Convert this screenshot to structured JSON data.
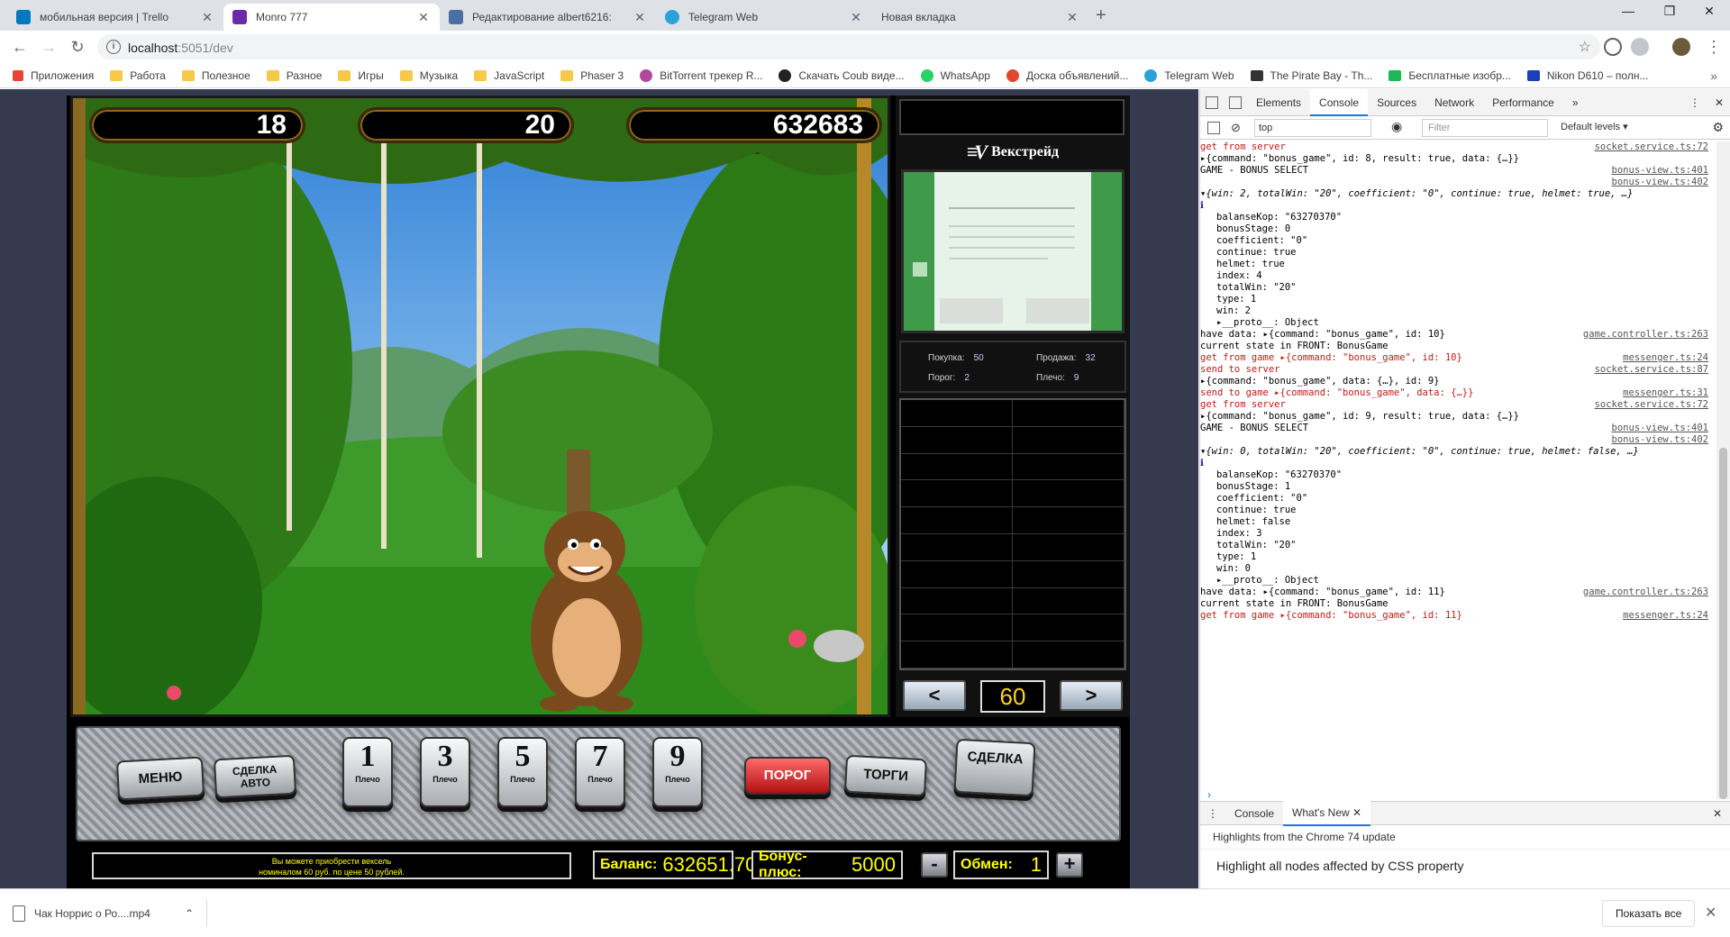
{
  "browser": {
    "tabs": [
      {
        "label": "мобильная версия | Trello",
        "icon_color": "#0079bf"
      },
      {
        "label": "Monro 777",
        "icon_color": "#6b2aa8"
      },
      {
        "label": "Редактирование albert6216:",
        "icon_color": "#4a6fa5"
      },
      {
        "label": "Telegram Web",
        "icon_color": "#2aa3dd"
      },
      {
        "label": "Новая вкладка",
        "icon_color": ""
      }
    ],
    "new_tab": "+",
    "url_host": "localhost",
    "url_rest": ":5051/dev",
    "win_min": "—",
    "win_max": "❐",
    "win_close": "✕",
    "bookmarks": [
      {
        "label": "Приложения",
        "icon": "apps-grid-icon"
      },
      {
        "label": "Работа",
        "icon": "folder-icon"
      },
      {
        "label": "Полезное",
        "icon": "folder-icon"
      },
      {
        "label": "Разное",
        "icon": "folder-icon"
      },
      {
        "label": "Игры",
        "icon": "folder-icon"
      },
      {
        "label": "Музыка",
        "icon": "folder-icon"
      },
      {
        "label": "JavaScript",
        "icon": "folder-icon"
      },
      {
        "label": "Phaser 3",
        "icon": "folder-icon"
      },
      {
        "label": "BitTorrent трекер R...",
        "icon": "bittorrent-icon"
      },
      {
        "label": "Скачать Coub виде...",
        "icon": "coub-icon"
      },
      {
        "label": "WhatsApp",
        "icon": "whatsapp-icon"
      },
      {
        "label": "Доска объявлений...",
        "icon": "board-icon"
      },
      {
        "label": "Telegram Web",
        "icon": "telegram-icon"
      },
      {
        "label": "The Pirate Bay - Th...",
        "icon": "pirate-icon"
      },
      {
        "label": "Бесплатные изобр...",
        "icon": "px-icon"
      },
      {
        "label": "Nikon D610 – полн...",
        "icon": "nikon-icon"
      }
    ],
    "bookmarks_more": "»"
  },
  "game": {
    "counters": [
      "18",
      "20",
      "632683"
    ],
    "brand": "Векстрейд",
    "stats": {
      "buy_label": "Покупка:",
      "buy_value": "50",
      "sell_label": "Продажа:",
      "sell_value": "32",
      "threshold_label": "Порог:",
      "threshold_value": "2",
      "leverage_label": "Плечо:",
      "leverage_value": "9"
    },
    "nav": {
      "prev": "<",
      "value": "60",
      "next": ">"
    },
    "buttons": {
      "menu": "МЕНЮ",
      "auto_deal": "СДЕЛКА АВТО",
      "lines": [
        {
          "num": "1",
          "label": "Плечо"
        },
        {
          "num": "3",
          "label": "Плечо"
        },
        {
          "num": "5",
          "label": "Плечо"
        },
        {
          "num": "7",
          "label": "Плечо"
        },
        {
          "num": "9",
          "label": "Плечо"
        }
      ],
      "threshold": "ПОРОГ",
      "trade": "ТОРГИ",
      "deal": "СДЕЛКА"
    },
    "message_line1": "Вы можете приобрести вексель",
    "message_line2": "номиналом 60 руб. по цене 50 рублей.",
    "balance_label": "Баланс:",
    "balance_value": "632651.70",
    "bonus_label": "Бонус-плюс:",
    "bonus_value": "5000",
    "exchange_minus": "-",
    "exchange_label": "Обмен:",
    "exchange_value": "1",
    "exchange_plus": "+"
  },
  "devtools": {
    "tabs": [
      "Elements",
      "Console",
      "Sources",
      "Network",
      "Performance",
      "»"
    ],
    "active_tab": "Console",
    "context": "top",
    "filter_placeholder": "Filter",
    "levels": "Default levels ▾",
    "log": [
      {
        "text": "get from server",
        "cls": "red",
        "src": "socket.service.ts:72"
      },
      {
        "text": "▸{command: \"bonus_game\", id: 8, result: true, data: {…}}",
        "cls": ""
      },
      {
        "text": "GAME - BONUS SELECT",
        "cls": "",
        "src": "bonus-view.ts:401"
      },
      {
        "text": "",
        "cls": "",
        "src": "bonus-view.ts:402"
      },
      {
        "text": "▾{win: 2, totalWin: \"20\", coefficient: \"0\", continue: true, helmet: true, …}",
        "cls": "ital"
      },
      {
        "text": "  ℹ",
        "cls": "blue"
      },
      {
        "text": "balanseKop: \"63270370\"",
        "cls": "prop"
      },
      {
        "text": "bonusStage: 0",
        "cls": "prop"
      },
      {
        "text": "coefficient: \"0\"",
        "cls": "prop"
      },
      {
        "text": "continue: true",
        "cls": "prop"
      },
      {
        "text": "helmet: true",
        "cls": "prop"
      },
      {
        "text": "index: 4",
        "cls": "prop"
      },
      {
        "text": "totalWin: \"20\"",
        "cls": "prop"
      },
      {
        "text": "type: 1",
        "cls": "prop"
      },
      {
        "text": "win: 2",
        "cls": "prop"
      },
      {
        "text": "▸__proto__: Object",
        "cls": "prop"
      },
      {
        "text": "have data:  ▸{command: \"bonus_game\", id: 10}",
        "cls": "",
        "src": "game.controller.ts:263"
      },
      {
        "text": " current state in FRONT: BonusGame",
        "cls": ""
      },
      {
        "text": "get from game  ▸{command: \"bonus_game\", id: 10}",
        "cls": "red",
        "src": "messenger.ts:24"
      },
      {
        "text": "send to server",
        "cls": "red",
        "src": "socket.service.ts:87"
      },
      {
        "text": "▸{command: \"bonus_game\", data: {…}, id: 9}",
        "cls": ""
      },
      {
        "text": "send to game  ▸{command: \"bonus_game\", data: {…}}",
        "cls": "red",
        "src": "messenger.ts:31"
      },
      {
        "text": "get from server",
        "cls": "red",
        "src": "socket.service.ts:72"
      },
      {
        "text": "▸{command: \"bonus_game\", id: 9, result: true, data: {…}}",
        "cls": ""
      },
      {
        "text": "GAME - BONUS SELECT",
        "cls": "",
        "src": "bonus-view.ts:401"
      },
      {
        "text": "",
        "cls": "",
        "src": "bonus-view.ts:402"
      },
      {
        "text": "▾{win: 0, totalWin: \"20\", coefficient: \"0\", continue: true, helmet: false, …}",
        "cls": "ital"
      },
      {
        "text": "  ℹ",
        "cls": "blue"
      },
      {
        "text": "balanseKop: \"63270370\"",
        "cls": "prop"
      },
      {
        "text": "bonusStage: 1",
        "cls": "prop"
      },
      {
        "text": "coefficient: \"0\"",
        "cls": "prop"
      },
      {
        "text": "continue: true",
        "cls": "prop"
      },
      {
        "text": "helmet: false",
        "cls": "prop"
      },
      {
        "text": "index: 3",
        "cls": "prop"
      },
      {
        "text": "totalWin: \"20\"",
        "cls": "prop"
      },
      {
        "text": "type: 1",
        "cls": "prop"
      },
      {
        "text": "win: 0",
        "cls": "prop"
      },
      {
        "text": "▸__proto__: Object",
        "cls": "prop"
      },
      {
        "text": "have data:  ▸{command: \"bonus_game\", id: 11}",
        "cls": "",
        "src": "game.controller.ts:263"
      },
      {
        "text": " current state in FRONT: BonusGame",
        "cls": ""
      },
      {
        "text": "get from game  ▸{command: \"bonus_game\", id: 11}",
        "cls": "red",
        "src": "messenger.ts:24"
      }
    ],
    "prompt": "›",
    "drawer_tabs": [
      "Console",
      "What's New ✕"
    ],
    "drawer_close": "✕",
    "whats_new_title": "Highlights from the Chrome 74 update",
    "whats_new_item": "Highlight all nodes affected by CSS property"
  },
  "downloads": {
    "file": "Чак Норрис о Ро....mp4",
    "show_all": "Показать все",
    "close": "✕"
  }
}
